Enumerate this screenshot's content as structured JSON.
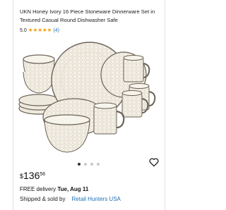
{
  "product": {
    "title": "UKN Honey Ivory 16 Piece Stoneware Dinnerware Set in Textured Casual Round Dishwasher Safe",
    "rating_value": "5.0",
    "stars": 5,
    "review_count": "(4)",
    "price_currency": "$",
    "price_dollars": "136",
    "price_cents": "56",
    "delivery_prefix": "FREE delivery",
    "delivery_date": "Tue, Aug 11",
    "shipped_label": "Shipped & sold by",
    "seller": "Retail Hunters USA"
  },
  "carousel": {
    "total": 4,
    "active_index": 0
  },
  "icons": {
    "heart": "heart-icon",
    "star": "star-icon"
  },
  "colors": {
    "star": "#f59e0b",
    "link": "#1d6fb8",
    "plate": "#f4f0e6",
    "rim": "#6b6257"
  }
}
